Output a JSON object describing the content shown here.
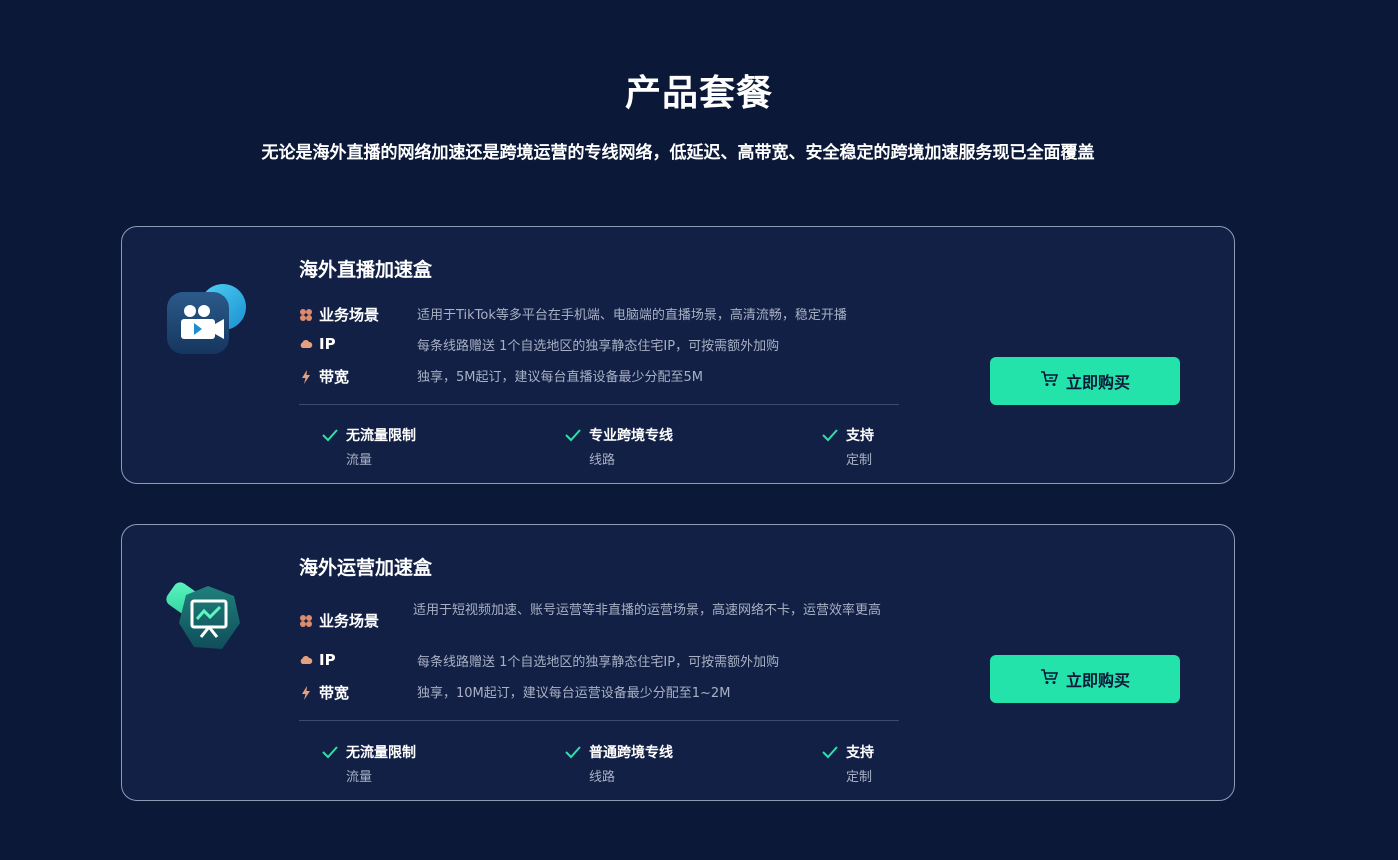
{
  "header": {
    "title": "产品套餐",
    "subtitle": "无论是海外直播的网络加速还是跨境运营的专线网络，低延迟、高带宽、安全稳定的跨境加速服务现已全面覆盖"
  },
  "colors": {
    "background": "#0b1838",
    "card": "#122045",
    "accent": "#23e3ab",
    "muted_text": "#a8b0c4"
  },
  "products": [
    {
      "icon": "video-camera-icon",
      "title": "海外直播加速盒",
      "specs": [
        {
          "icon": "flower-icon",
          "key": "业务场景",
          "value": "适用于TikTok等多平台在手机端、电脑端的直播场景，高清流畅，稳定开播"
        },
        {
          "icon": "cloud-icon",
          "key": "IP",
          "value": "每条线路赠送 1个自选地区的独享静态住宅IP，可按需额外加购"
        },
        {
          "icon": "lightning-icon",
          "key": "带宽",
          "value": "独享，5M起订，建议每台直播设备最少分配至5M"
        }
      ],
      "features": [
        {
          "title": "无流量限制",
          "sub": "流量"
        },
        {
          "title": "专业跨境专线",
          "sub": "线路"
        },
        {
          "title": "支持",
          "sub": "定制"
        }
      ],
      "buy_label": "立即购买"
    },
    {
      "icon": "presentation-chart-icon",
      "title": "海外运营加速盒",
      "specs": [
        {
          "icon": "flower-icon",
          "key": "业务场景",
          "value": "适用于短视频加速、账号运营等非直播的运营场景，高速网络不卡，运营效率更高"
        },
        {
          "icon": "cloud-icon",
          "key": "IP",
          "value": "每条线路赠送 1个自选地区的独享静态住宅IP，可按需额外加购"
        },
        {
          "icon": "lightning-icon",
          "key": "带宽",
          "value": "独享，10M起订，建议每台运营设备最少分配至1~2M"
        }
      ],
      "features": [
        {
          "title": "无流量限制",
          "sub": "流量"
        },
        {
          "title": "普通跨境专线",
          "sub": "线路"
        },
        {
          "title": "支持",
          "sub": "定制"
        }
      ],
      "buy_label": "立即购买"
    }
  ]
}
